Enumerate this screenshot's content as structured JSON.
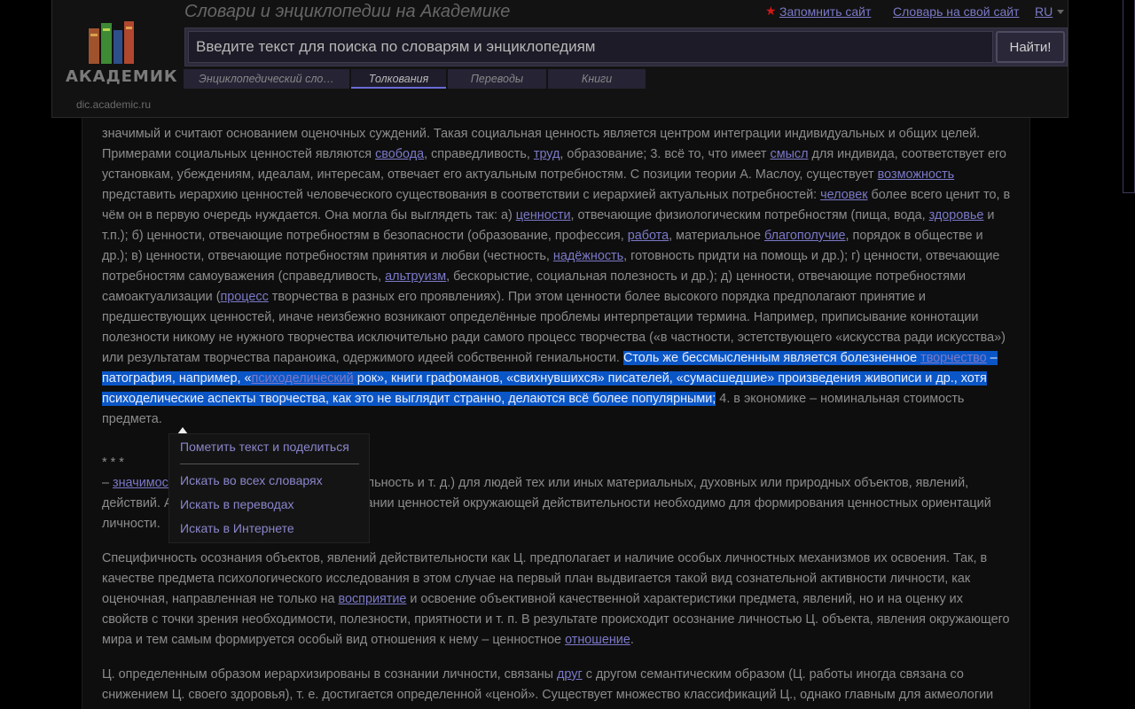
{
  "header": {
    "site_title": "Словари и энциклопедии на Академике",
    "logo_text": "АКАДЕМИК",
    "logo_url": "dic.academic.ru",
    "links": {
      "remember": "Запомнить сайт",
      "dictionary": "Словарь на свой сайт",
      "lang": "RU"
    },
    "search": {
      "placeholder": "Введите текст для поиска по словарям и энциклопедиям",
      "button": "Найти!"
    },
    "tabs": [
      {
        "label": "Энциклопедический сло…",
        "active": false
      },
      {
        "label": "Толкования",
        "active": true
      },
      {
        "label": "Переводы",
        "active": false
      },
      {
        "label": "Книги",
        "active": false
      }
    ]
  },
  "article": {
    "p1": {
      "t0": "значимый и считают основанием оценочных суждений. Такая социальная ценность является центром интеграции индивидуальных и общих целей. Примерами социальных ценностей являются ",
      "l_freedom": "свобода",
      "t1": ", справедливость, ",
      "l_labor": "труд",
      "t2": ", образование; 3. всё то, что имеет ",
      "l_meaning": "смысл",
      "t3": " для индивида, соответствует его установкам, убеждениям, идеалам, интересам, отвечает его актуальным потребностям. С позиции теории А. Маслоу, существует ",
      "l_possibility": "возможность",
      "t4": " представить иерархию ценностей человеческого существования в соответствии с иерархией актуальных потребностей: ",
      "l_human": "человек",
      "t5": " более всего ценит то, в чём он в первую очередь нуждается. Она могла бы выглядеть так: а) ",
      "l_values": "ценности",
      "t6": ", отвечающие физиологическим потребностям (пища, вода, ",
      "l_health": "здоровье",
      "t7": " и т.п.); б) ценности, отвечающие потребностям в безопасности (образование, профессия, ",
      "l_work": "работа",
      "t8": ", материальное ",
      "l_welfare": "благополучие",
      "t9": ", порядок в обществе и др.); в) ценности, отвечающие потребностям принятия и любви (честность, ",
      "l_reliability": "надёжность",
      "t10": ", готовность придти на помощь и др.); г) ценности, отвечающие потребностям самоуважения (справедливость, ",
      "l_altruism": "альтруизм",
      "t11": ", бескорыстие, социальная полезность и др.); д) ценности, отвечающие потребностями самоактуализации (",
      "l_process": "процесс",
      "t12": " творчества в разных его проявлениях). При этом ценности более высокого порядка предполагают принятие и предшествующих ценностей, иначе неизбежно возникают определённые проблемы интерпретации термина. Например, приписывание коннотации полезности никому не нужного творчества исключительно ради самого процесс творчества («в частности, эстетствующего «искусства ради искусства») или результатам творчества параноика, одержимого идеей собственной гениальности. ",
      "s0": "Столь же бессмысленным является болезненное ",
      "l_creativity": "творчество",
      "s1": " – патография, например, «",
      "l_psychedelic": "психоделический",
      "s2": " рок», книги графоманов, «свихнувшихся» писателей, «сумасшедшие» произведения живописи и др., хотя психоделические аспекты творчества, как это не выглядит странно, делаются всё более популярными;",
      "t13": " 4. в экономике – номинальная стоимость предмета."
    },
    "stars": "* * *",
    "p2": {
      "t0": "– ",
      "l_significance": "значимость",
      "t1": " (важность, полезность, желательность и т. д.) для людей тех или иных материальных, духовных или природных объектов, явлений, действий. Адекватная репрезентация в сознании ценностей окружающей действительности необходимо для формирования ценностных ориентаций личности."
    },
    "p3": {
      "t0": "Специфичность осознания объектов, явлений действительности как Ц. предполагает и наличие особых личностных механизмов их освоения. Так, в качестве предмета психологического исследования в этом случае на первый план выдвигается такой вид сознательной активности личности, как оценочная, направленная не только на ",
      "l_perception": "восприятие",
      "t1": " и освоение объективной качественной характеристики предмета, явлений, но и на оценку их свойств с точки зрения необходимости, полезности, приятности и т. п. В результате происходит осознание личностью Ц. объекта, явления окружающего мира и тем самым формируется особый вид отношения к нему – ценностное ",
      "l_relation": "отношение",
      "t2": "."
    },
    "p4": {
      "t0": "Ц. определенным образом иерархизированы в сознании личности, связаны ",
      "l_friend": "друг",
      "t1": " с другом семантическим образом (Ц. работы иногда связана со снижением Ц. своего здоровья), т. е. достигается определенной «ценой». Существует множество классификаций Ц., однако главным для акмеологии является"
    }
  },
  "popup": {
    "share": "Пометить текст и поделиться",
    "search_all": "Искать во всех словарях",
    "search_translations": "Искать в переводах",
    "search_internet": "Искать в Интернете"
  },
  "colors": {
    "link": "#7b79c8",
    "selection": "#0b56c6",
    "star": "#d01818"
  }
}
